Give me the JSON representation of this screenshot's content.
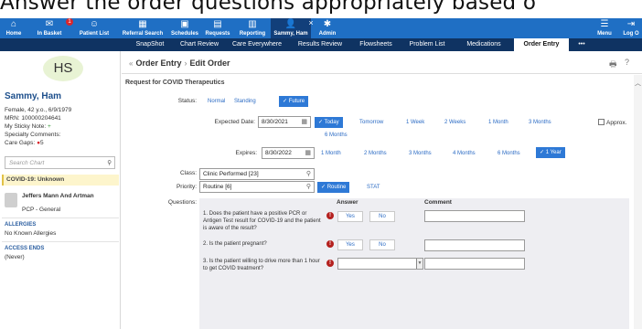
{
  "banner": "Answer the order questions appropriately based o",
  "topbar": {
    "items": [
      {
        "label": "Home",
        "icon": "home-icon",
        "glyph": "⌂"
      },
      {
        "label": "In Basket",
        "icon": "inbox-icon",
        "glyph": "✉",
        "badge": "1"
      },
      {
        "label": "Patient List",
        "icon": "patient-list-icon",
        "glyph": "☺"
      },
      {
        "label": "Referral Search",
        "icon": "referral-search-icon",
        "glyph": "▦"
      },
      {
        "label": "Schedules",
        "icon": "calendar-icon",
        "glyph": "▣"
      },
      {
        "label": "Requests",
        "icon": "requests-icon",
        "glyph": "▤"
      },
      {
        "label": "Reporting",
        "icon": "reporting-icon",
        "glyph": "▥"
      },
      {
        "label": "Sammy, Ham",
        "icon": "patient-icon",
        "glyph": "👤"
      },
      {
        "label": "Admin",
        "icon": "gear-icon",
        "glyph": "✱"
      }
    ],
    "menu_label": "Menu",
    "logout_label": "Log O",
    "close_glyph": "×"
  },
  "tabs": [
    "SnapShot",
    "Chart Review",
    "Care Everywhere",
    "Results Review",
    "Flowsheets",
    "Problem List",
    "Medications",
    "Order Entry",
    "•••"
  ],
  "active_tab": "Order Entry",
  "patient": {
    "initials": "HS",
    "name": "Sammy, Ham",
    "demographics": "Female, 42 y.o., 6/9/1979",
    "mrn": "MRN: 100000204641",
    "sticky": "My Sticky Note:",
    "specialty": "Specialty Comments:",
    "care_gaps": "Care Gaps:",
    "care_gaps_count": "5",
    "search_placeholder": "Search Chart",
    "covid": "COVID-19: Unknown",
    "pcp_name": "Jeffers Mann And Artman",
    "pcp_role": "PCP - General",
    "allergies_h": "ALLERGIES",
    "allergies": "No Known Allergies",
    "access_h": "ACCESS ENDS",
    "access": "(Never)"
  },
  "breadcrumb": {
    "first": "Order Entry",
    "sep": "›",
    "second": "Edit Order"
  },
  "order": {
    "section_title": "Request for COVID Therapeutics",
    "status_label": "Status:",
    "status_options": [
      "Normal",
      "Standing",
      "✓ Future"
    ],
    "expected_label": "Expected Date:",
    "expected_value": "8/30/2021",
    "expected_options": [
      "✓ Today",
      "Tomorrow",
      "1 Week",
      "2 Weeks",
      "1 Month",
      "3 Months",
      "6 Months"
    ],
    "approx_label": "Approx.",
    "expires_label": "Expires:",
    "expires_value": "8/30/2022",
    "expires_options": [
      "1 Month",
      "2 Months",
      "3 Months",
      "4 Months",
      "6 Months",
      "✓ 1 Year"
    ],
    "class_label": "Class:",
    "class_value": "Clinic Performed [23]",
    "priority_label": "Priority:",
    "priority_value": "Routine [6]",
    "priority_options": [
      "✓ Routine",
      "STAT"
    ],
    "questions_label": "Questions:",
    "answer_header": "Answer",
    "comment_header": "Comment",
    "questions": [
      {
        "text": "1. Does the patient have a positive PCR or Antigen Test result for COVID-19 and the patient is aware of the result?",
        "yes": "Yes",
        "no": "No"
      },
      {
        "text": "2. Is the patient pregnant?",
        "yes": "Yes",
        "no": "No"
      },
      {
        "text": "3. Is the patient willing to drive more than 1 hour to get COVID treatment?"
      }
    ]
  }
}
